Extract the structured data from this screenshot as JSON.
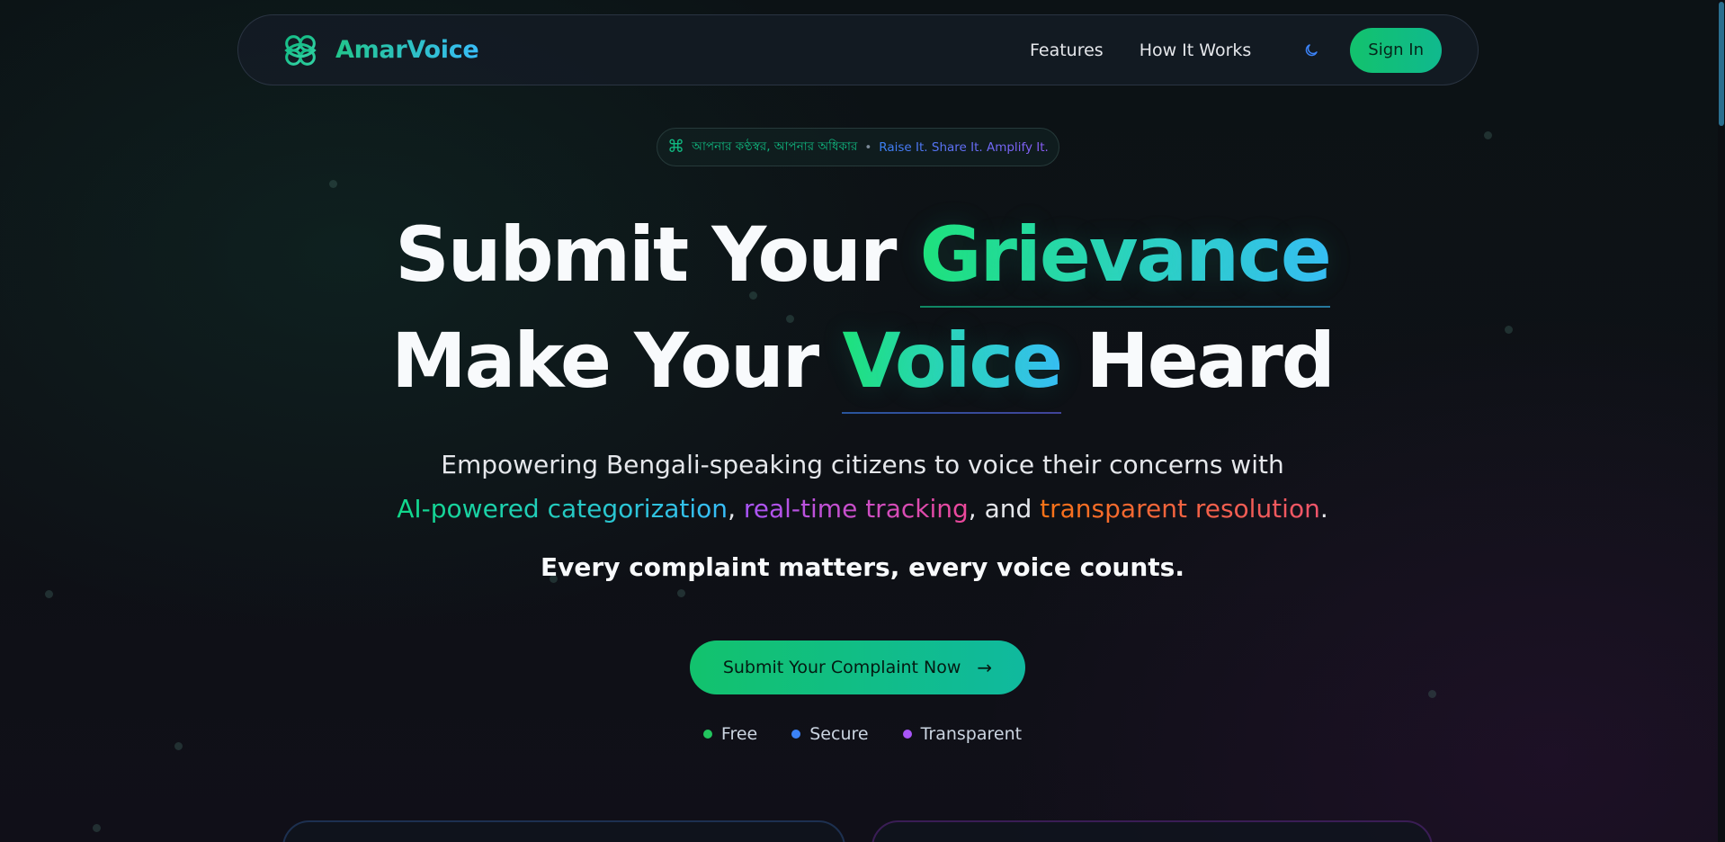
{
  "brand": {
    "name": "AmarVoice",
    "logo_icon": "celtic-knot-icon"
  },
  "nav": {
    "links": [
      {
        "label": "Features"
      },
      {
        "label": "How It Works"
      }
    ],
    "theme_toggle_icon": "moon-icon",
    "signin_label": "Sign In"
  },
  "tagline": {
    "icon": "command-icon",
    "bengali": "আপনার কণ্ঠস্বর, আপনার অধিকার",
    "separator": "•",
    "english": "Raise It. Share It. Amplify It."
  },
  "hero": {
    "line1_prefix": "Submit Your ",
    "line1_highlight": "Grievance",
    "line2_prefix": "Make Your ",
    "line2_highlight": "Voice",
    "line2_suffix": " Heard"
  },
  "description": {
    "line1": "Empowering Bengali-speaking citizens to voice their concerns with",
    "part_ai": "AI-powered categorization",
    "comma1": ",",
    "part_tracking": "real-time tracking",
    "and_text": ", and",
    "part_resolution": "transparent resolution",
    "period": ".",
    "motto": "Every complaint matters, every voice counts."
  },
  "cta": {
    "label": "Submit Your Complaint Now",
    "icon": "arrow-right-icon"
  },
  "badges": [
    {
      "label": "Free",
      "color": "#22c55e"
    },
    {
      "label": "Secure",
      "color": "#3b82f6"
    },
    {
      "label": "Transparent",
      "color": "#a855f7"
    }
  ],
  "colors": {
    "accent_green": "#12c26d",
    "accent_blue": "#38bdf8",
    "accent_purple": "#a855f7",
    "accent_orange": "#f97316",
    "background": "#0d1116"
  }
}
